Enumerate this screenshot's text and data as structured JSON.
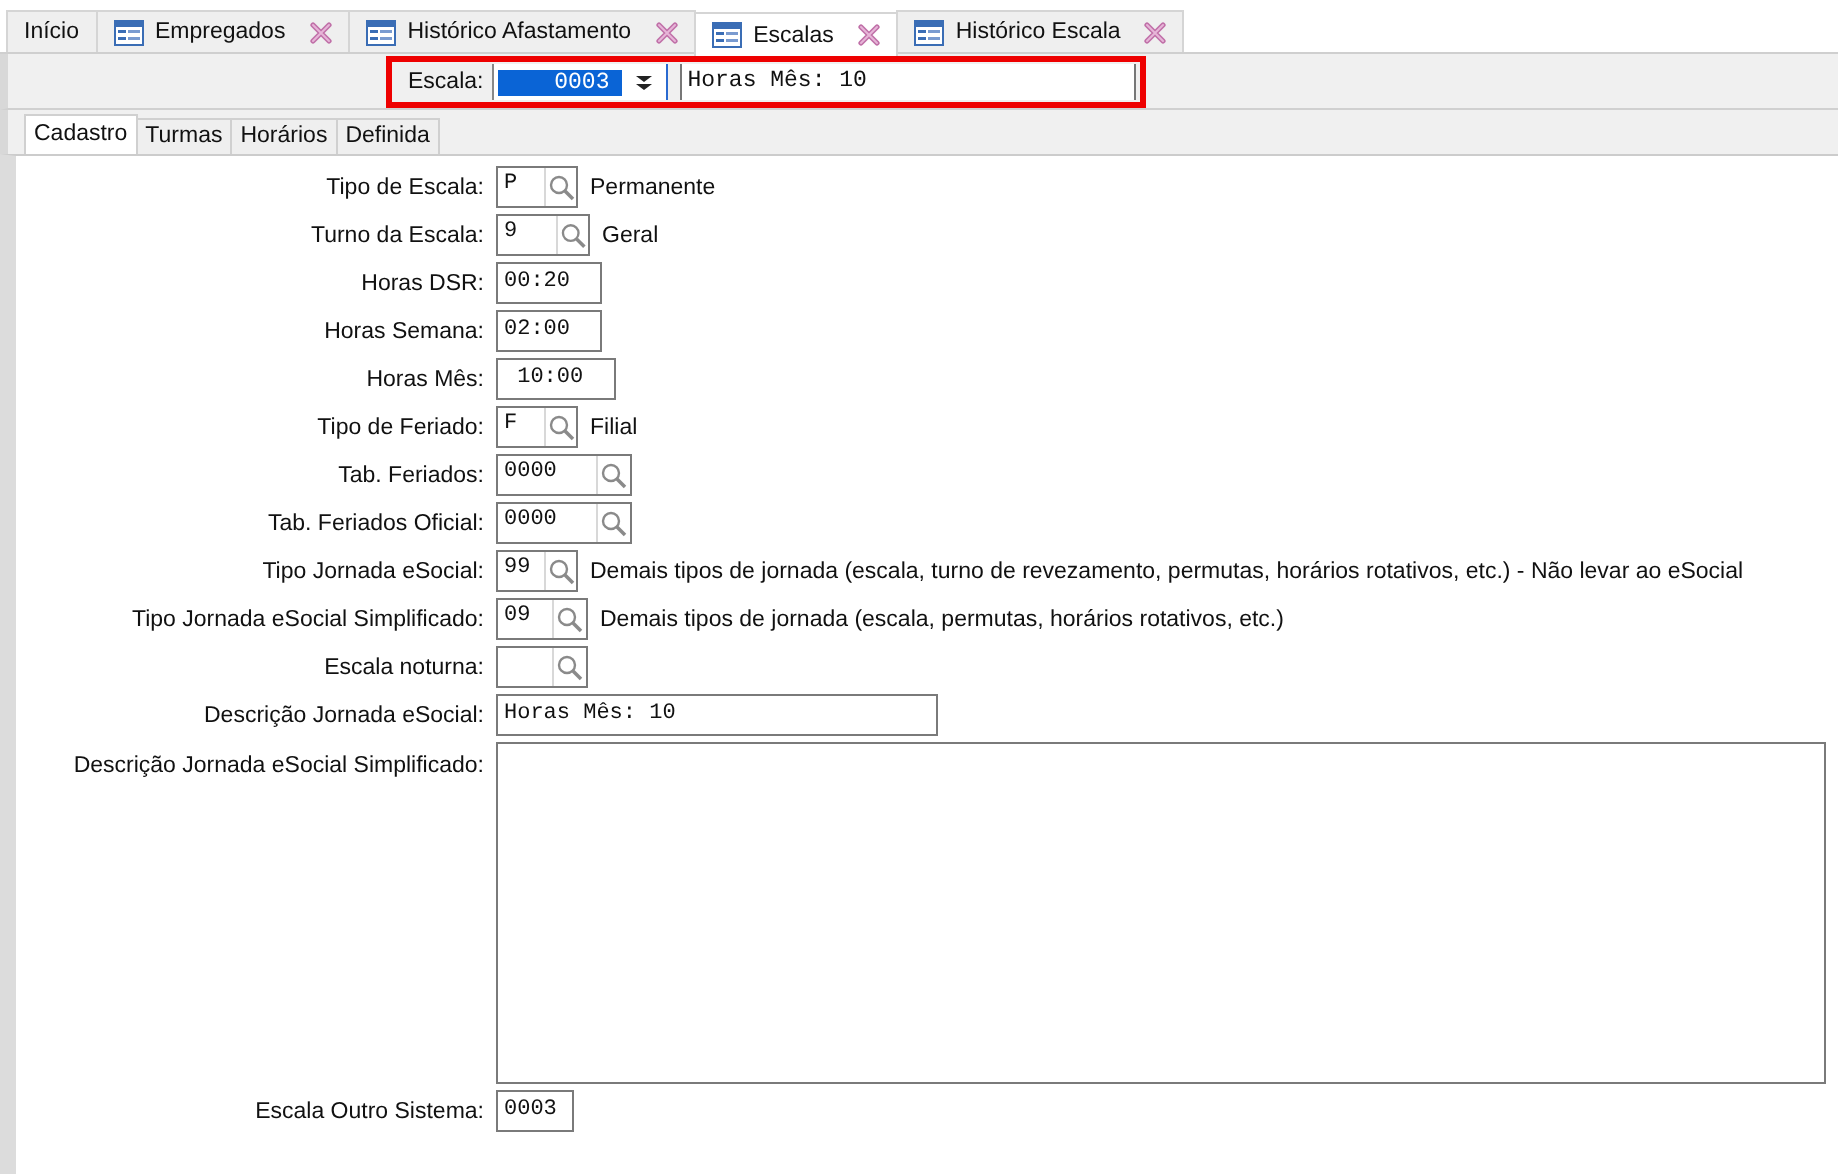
{
  "tabs": [
    {
      "label": "Início",
      "selected": false,
      "icon": false,
      "closable": false
    },
    {
      "label": "Empregados",
      "selected": false,
      "icon": true,
      "closable": true
    },
    {
      "label": "Histórico Afastamento",
      "selected": false,
      "icon": true,
      "closable": true
    },
    {
      "label": "Escalas",
      "selected": true,
      "icon": true,
      "closable": true
    },
    {
      "label": "Histórico Escala",
      "selected": false,
      "icon": true,
      "closable": true
    }
  ],
  "selector": {
    "label": "Escala:",
    "value": "0003",
    "description": "Horas Mês: 10",
    "highlighted": true
  },
  "subtabs": [
    {
      "label": "Cadastro",
      "selected": true
    },
    {
      "label": "Turmas",
      "selected": false
    },
    {
      "label": "Horários",
      "selected": false
    },
    {
      "label": "Definida",
      "selected": false
    }
  ],
  "fields": [
    {
      "kind": "lookup",
      "label": "Tipo de Escala:",
      "value": "P",
      "description": "Permanente"
    },
    {
      "kind": "lookup",
      "label": "Turno da Escala:",
      "value": "9",
      "description": "Geral"
    },
    {
      "kind": "text",
      "label": "Horas DSR:",
      "value": "00:20"
    },
    {
      "kind": "text",
      "label": "Horas Semana:",
      "value": "02:00"
    },
    {
      "kind": "text",
      "label": "Horas Mês:",
      "value": " 10:00"
    },
    {
      "kind": "lookup",
      "label": "Tipo de Feriado:",
      "value": "F",
      "description": "Filial"
    },
    {
      "kind": "lookup",
      "label": "Tab. Feriados:",
      "value": "0000"
    },
    {
      "kind": "lookup",
      "label": "Tab. Feriados Oficial:",
      "value": "0000"
    },
    {
      "kind": "lookup",
      "label": "Tipo Jornada eSocial:",
      "value": "99",
      "description": "Demais tipos de jornada (escala, turno de revezamento, permutas, horários rotativos, etc.) - Não levar ao eSocial"
    },
    {
      "kind": "lookup",
      "label": "Tipo Jornada eSocial Simplificado:",
      "value": "09",
      "description": "Demais tipos de jornada (escala, permutas, horários rotativos, etc.)"
    },
    {
      "kind": "lookup",
      "label": "Escala noturna:"
    },
    {
      "kind": "text",
      "label": "Descrição Jornada eSocial:",
      "value": "Horas Mês: 10"
    },
    {
      "kind": "textarea",
      "label": "Descrição Jornada eSocial Simplificado:"
    },
    {
      "kind": "text",
      "label": "Escala Outro Sistema:",
      "value": "0003"
    }
  ]
}
